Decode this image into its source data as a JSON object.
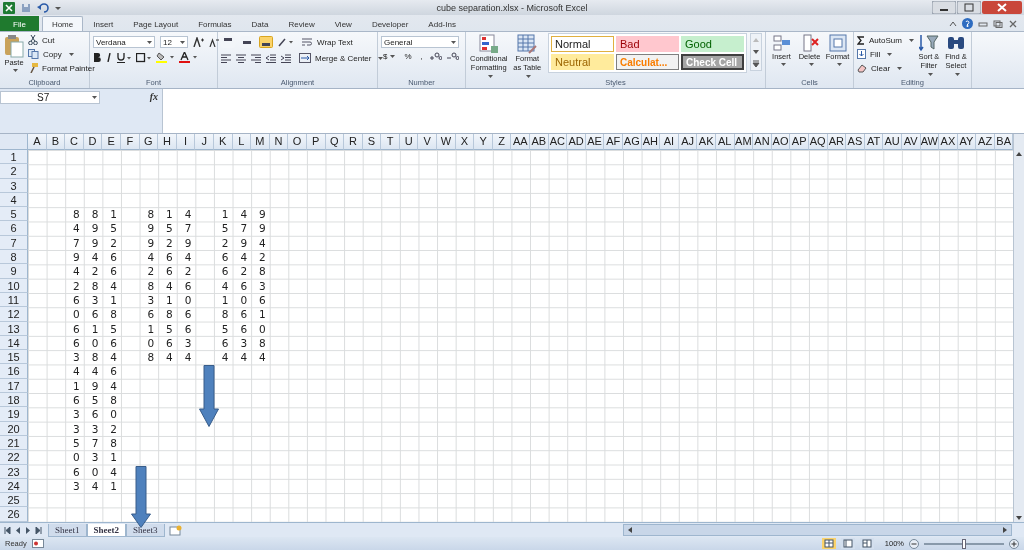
{
  "window": {
    "title": "cube separation.xlsx - Microsoft Excel"
  },
  "ribbon_tabs": [
    {
      "label": "File",
      "kind": "file",
      "selected": false
    },
    {
      "label": "Home",
      "kind": "tab",
      "selected": true
    },
    {
      "label": "Insert",
      "kind": "tab",
      "selected": false
    },
    {
      "label": "Page Layout",
      "kind": "tab",
      "selected": false
    },
    {
      "label": "Formulas",
      "kind": "tab",
      "selected": false
    },
    {
      "label": "Data",
      "kind": "tab",
      "selected": false
    },
    {
      "label": "Review",
      "kind": "tab",
      "selected": false
    },
    {
      "label": "View",
      "kind": "tab",
      "selected": false
    },
    {
      "label": "Developer",
      "kind": "tab",
      "selected": false
    },
    {
      "label": "Add-Ins",
      "kind": "tab",
      "selected": false
    }
  ],
  "clipboard": {
    "label": "Clipboard",
    "paste": "Paste",
    "cut": "Cut",
    "copy": "Copy",
    "format_painter": "Format Painter"
  },
  "font": {
    "label": "Font",
    "font_name": "Verdana",
    "font_size": "12"
  },
  "alignment": {
    "label": "Alignment",
    "vertical_align": [
      {
        "selected": false
      },
      {
        "selected": false
      },
      {
        "selected": true
      }
    ],
    "wrap_text": "Wrap Text",
    "merge_center": "Merge & Center"
  },
  "number": {
    "label": "Number",
    "format": "General",
    "currency": "$",
    "percent": "%",
    "comma": ","
  },
  "styles": {
    "label": "Styles",
    "conditional_formatting": "Conditional Formatting",
    "format_as_table": "Format as Table",
    "cell_styles": [
      {
        "label": "Normal",
        "kind": "normal"
      },
      {
        "label": "Bad",
        "kind": "bad"
      },
      {
        "label": "Good",
        "kind": "good"
      },
      {
        "label": "Neutral",
        "kind": "neutral"
      },
      {
        "label": "Calculat...",
        "kind": "calculation"
      },
      {
        "label": "Check Cell",
        "kind": "check"
      }
    ]
  },
  "cells_group": {
    "label": "Cells",
    "insert": "Insert",
    "delete": "Delete",
    "format": "Format"
  },
  "editing": {
    "label": "Editing",
    "autosum": "AutoSum",
    "fill": "Fill",
    "clear": "Clear",
    "sort_filter": "Sort & Filter",
    "find_select": "Find & Select"
  },
  "formula_bar": {
    "name_box": "S7",
    "insert_function": "fx"
  },
  "sheet": {
    "columns": [
      "A",
      "B",
      "C",
      "D",
      "E",
      "F",
      "G",
      "H",
      "I",
      "J",
      "K",
      "L",
      "M",
      "N",
      "O",
      "P",
      "Q",
      "R",
      "S",
      "T",
      "U",
      "V",
      "W",
      "X",
      "Y",
      "Z",
      "AA",
      "AB",
      "AC",
      "AD",
      "AE",
      "AF",
      "AG",
      "AH",
      "AI",
      "AJ",
      "AK",
      "AL",
      "AM",
      "AN",
      "AO",
      "AP",
      "AQ",
      "AR",
      "AS",
      "AT",
      "AU",
      "AV",
      "AW",
      "AX",
      "AY",
      "AZ",
      "BA"
    ],
    "rows": [
      {
        "header": "1",
        "cells": {}
      },
      {
        "header": "2",
        "cells": {}
      },
      {
        "header": "3",
        "cells": {}
      },
      {
        "header": "4",
        "cells": {}
      },
      {
        "header": "5",
        "cells": {
          "C": "8",
          "D": "8",
          "E": "1",
          "G": "8",
          "H": "1",
          "I": "4",
          "K": "1",
          "L": "4",
          "M": "9"
        }
      },
      {
        "header": "6",
        "cells": {
          "C": "4",
          "D": "9",
          "E": "5",
          "G": "9",
          "H": "5",
          "I": "7",
          "K": "5",
          "L": "7",
          "M": "9"
        }
      },
      {
        "header": "7",
        "cells": {
          "C": "7",
          "D": "9",
          "E": "2",
          "G": "9",
          "H": "2",
          "I": "9",
          "K": "2",
          "L": "9",
          "M": "4"
        }
      },
      {
        "header": "8",
        "cells": {
          "C": "9",
          "D": "4",
          "E": "6",
          "G": "4",
          "H": "6",
          "I": "4",
          "K": "6",
          "L": "4",
          "M": "2"
        }
      },
      {
        "header": "9",
        "cells": {
          "C": "4",
          "D": "2",
          "E": "6",
          "G": "2",
          "H": "6",
          "I": "2",
          "K": "6",
          "L": "2",
          "M": "8"
        }
      },
      {
        "header": "10",
        "cells": {
          "C": "2",
          "D": "8",
          "E": "4",
          "G": "8",
          "H": "4",
          "I": "6",
          "K": "4",
          "L": "6",
          "M": "3"
        }
      },
      {
        "header": "11",
        "cells": {
          "C": "6",
          "D": "3",
          "E": "1",
          "G": "3",
          "H": "1",
          "I": "0",
          "K": "1",
          "L": "0",
          "M": "6"
        }
      },
      {
        "header": "12",
        "cells": {
          "C": "0",
          "D": "6",
          "E": "8",
          "G": "6",
          "H": "8",
          "I": "6",
          "K": "8",
          "L": "6",
          "M": "1"
        }
      },
      {
        "header": "13",
        "cells": {
          "C": "6",
          "D": "1",
          "E": "5",
          "G": "1",
          "H": "5",
          "I": "6",
          "K": "5",
          "L": "6",
          "M": "0"
        }
      },
      {
        "header": "14",
        "cells": {
          "C": "6",
          "D": "0",
          "E": "6",
          "G": "0",
          "H": "6",
          "I": "3",
          "K": "6",
          "L": "3",
          "M": "8"
        }
      },
      {
        "header": "15",
        "cells": {
          "C": "3",
          "D": "8",
          "E": "4",
          "G": "8",
          "H": "4",
          "I": "4",
          "K": "4",
          "L": "4",
          "M": "4"
        }
      },
      {
        "header": "16",
        "cells": {
          "C": "4",
          "D": "4",
          "E": "6"
        }
      },
      {
        "header": "17",
        "cells": {
          "C": "1",
          "D": "9",
          "E": "4"
        }
      },
      {
        "header": "18",
        "cells": {
          "C": "6",
          "D": "5",
          "E": "8"
        }
      },
      {
        "header": "19",
        "cells": {
          "C": "3",
          "D": "6",
          "E": "0"
        }
      },
      {
        "header": "20",
        "cells": {
          "C": "3",
          "D": "3",
          "E": "2"
        }
      },
      {
        "header": "21",
        "cells": {
          "C": "5",
          "D": "7",
          "E": "8"
        }
      },
      {
        "header": "22",
        "cells": {
          "C": "0",
          "D": "3",
          "E": "1"
        }
      },
      {
        "header": "23",
        "cells": {
          "C": "6",
          "D": "0",
          "E": "4"
        }
      },
      {
        "header": "24",
        "cells": {
          "C": "3",
          "D": "4",
          "E": "1"
        }
      },
      {
        "header": "25",
        "cells": {}
      },
      {
        "header": "26",
        "cells": {}
      }
    ]
  },
  "sheet_tabs": [
    {
      "label": "Sheet1",
      "selected": false
    },
    {
      "label": "Sheet2",
      "selected": true
    },
    {
      "label": "Sheet3",
      "selected": false
    }
  ],
  "status_bar": {
    "status": "Ready",
    "views": [
      {
        "selected": true
      },
      {
        "selected": false
      },
      {
        "selected": false
      }
    ],
    "zoom": "100%",
    "zoom_slider": {
      "level": 0.5
    }
  }
}
